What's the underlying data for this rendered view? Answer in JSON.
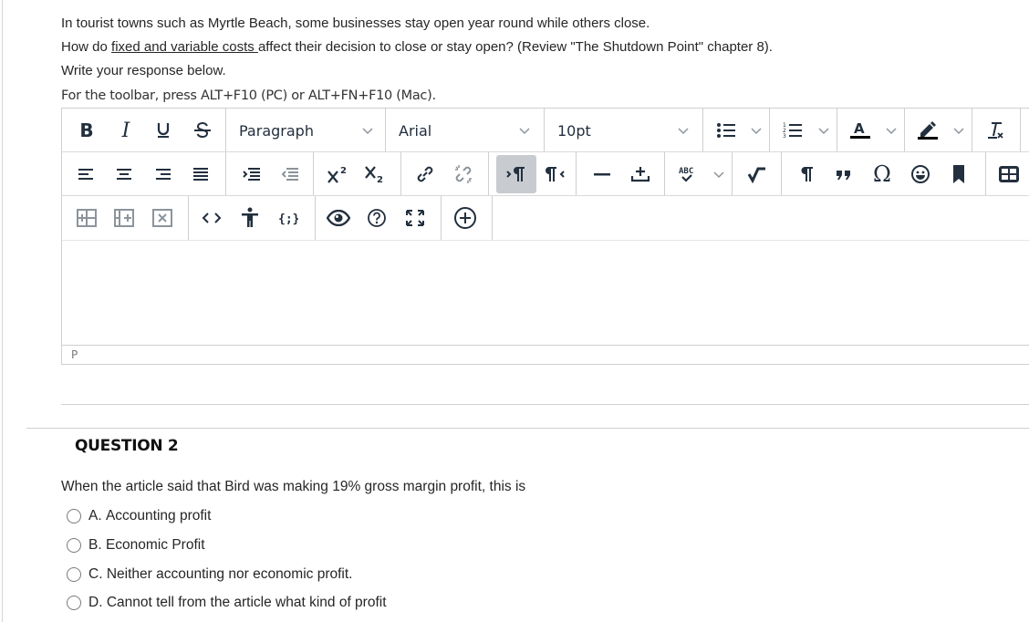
{
  "question1": {
    "line1": "In tourist towns such as Myrtle Beach, some businesses stay open year round while others close.",
    "line2_prefix": "How do ",
    "line2_link": "fixed and variable costs ",
    "line2_suffix": "affect their decision to close or stay open? (Review \"The Shutdown Point\" chapter 8).",
    "line3": "Write your response below.",
    "toolbar_hint": "For the toolbar, press ALT+F10 (PC) or ALT+FN+F10 (Mac)."
  },
  "editor": {
    "bold_label": "B",
    "italic_label": "I",
    "underline_label": "U",
    "strike_label": "S",
    "block_format": "Paragraph",
    "font_family": "Arial",
    "font_size": "10pt",
    "status_path": "P",
    "active_button": "ltr-paragraph"
  },
  "question2": {
    "title": "QUESTION 2",
    "text": "When the article said that Bird was making 19% gross margin profit, this is",
    "options": [
      {
        "letter": "A.",
        "label": "Accounting profit",
        "selected": false
      },
      {
        "letter": "B.",
        "label": "Economic Profit",
        "selected": false
      },
      {
        "letter": "C.",
        "label": "Neither accounting nor economic profit.",
        "selected": false
      },
      {
        "letter": "D.",
        "label": "Cannot tell from the article what kind of profit",
        "selected": false
      }
    ]
  },
  "colors": {
    "icon": "#222f3e",
    "icon_disabled": "#8c949c",
    "active_bg": "#c8cbcf",
    "border": "#cfcfcf"
  }
}
